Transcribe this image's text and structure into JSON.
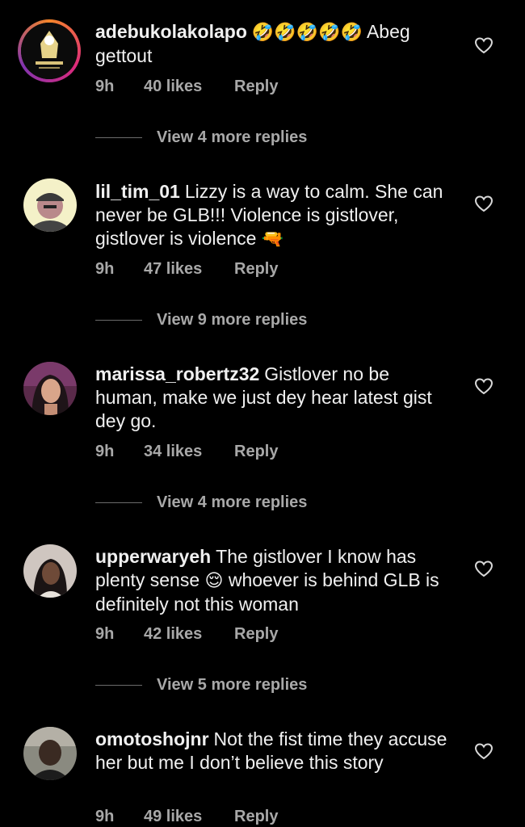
{
  "comments": [
    {
      "username": "adebukolakolapo",
      "text_parts": [
        "🤣🤣🤣🤣🤣",
        " Abeg gettout"
      ],
      "time": "9h",
      "likes": "40 likes",
      "reply": "Reply",
      "view_more": "View 4 more replies"
    },
    {
      "username": "lil_tim_01",
      "text_parts": [
        "Lizzy is a way to calm. She can never be GLB!!! Violence is gistlover, gistlover is violence ",
        "🔫"
      ],
      "time": "9h",
      "likes": "47 likes",
      "reply": "Reply",
      "view_more": "View 9 more replies"
    },
    {
      "username": "marissa_robertz32",
      "text_parts": [
        "Gistlover no be human, make we just dey hear latest gist dey go."
      ],
      "time": "9h",
      "likes": "34 likes",
      "reply": "Reply",
      "view_more": "View 4 more replies"
    },
    {
      "username": "upperwaryeh",
      "text_parts": [
        "The gistlover I know has plenty sense ",
        "😌",
        " whoever is behind GLB is definitely not this woman"
      ],
      "time": "9h",
      "likes": "42 likes",
      "reply": "Reply",
      "view_more": "View 5 more replies"
    },
    {
      "username": "omotoshojnr",
      "text_parts": [
        "Not the fist time they accuse her but me I don’t believe this story"
      ],
      "time": "9h",
      "likes": "49 likes",
      "reply": "Reply"
    }
  ],
  "colors": {
    "background": "#000000",
    "text": "#f0f0f0",
    "secondary": "#a8a8a8"
  },
  "icons": {
    "like": "heart-outline-icon"
  }
}
